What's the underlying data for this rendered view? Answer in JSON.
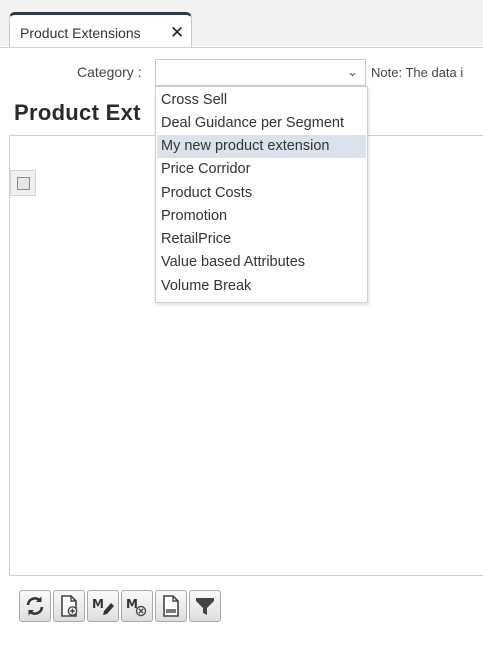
{
  "tab": {
    "label": "Product Extensions",
    "close_glyph": "✕"
  },
  "filter": {
    "category_label": "Category :",
    "category_value": "",
    "note": "Note: The data i"
  },
  "page_title": "Product Ext",
  "dropdown": {
    "options": [
      "Cross Sell",
      "Deal Guidance per Segment",
      "My new product extension",
      "Price Corridor",
      "Product Costs",
      "Promotion",
      "RetailPrice",
      "Value based Attributes",
      "Volume Break"
    ],
    "highlighted": "My new product extension"
  },
  "toolbar": {
    "buttons": [
      "refresh-icon",
      "new-document-icon",
      "mass-edit-icon",
      "mass-delete-icon",
      "export-icon",
      "filter-icon"
    ]
  },
  "colors": {
    "tab_accent": "#2b3a4a",
    "highlight": "#d9e3ee"
  }
}
